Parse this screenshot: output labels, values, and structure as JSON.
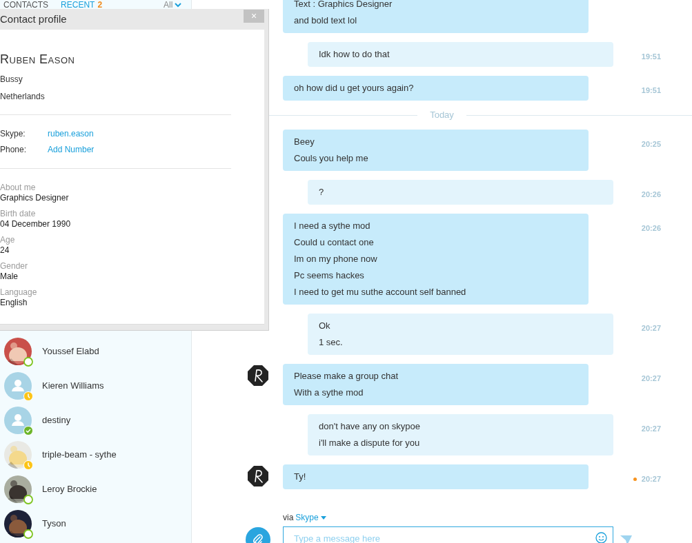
{
  "sidebar": {
    "tabs": [
      {
        "label": "CONTACTS",
        "selected": false
      },
      {
        "label": "RECENT",
        "badge": "2",
        "selected": true
      }
    ],
    "filter": "All",
    "contacts": [
      {
        "name": "Youssef Elabd",
        "away": false,
        "checked": false
      },
      {
        "name": "Kieren Williams",
        "kind": "default",
        "away": true,
        "checked": false
      },
      {
        "name": "destiny",
        "kind": "default",
        "away": false,
        "checked": true
      },
      {
        "name": "triple-beam - sythe",
        "away": true,
        "checked": false
      },
      {
        "name": "Leroy Brockie",
        "away": false,
        "checked": false
      },
      {
        "name": "Tyson",
        "away": false,
        "checked": false
      }
    ]
  },
  "profile": {
    "title": "Contact profile",
    "close": "×",
    "name": "Ruben Eason",
    "mood": "Bussy",
    "location": "Netherlands",
    "contact_fields": [
      {
        "label": "Skype:",
        "value": "ruben.eason"
      },
      {
        "label": "Phone:",
        "value": "Add Number"
      }
    ],
    "details": [
      {
        "label": "About me",
        "value": "Graphics Designer"
      },
      {
        "label": "Birth date",
        "value": "04 December 1990"
      },
      {
        "label": "Age",
        "value": "24"
      },
      {
        "label": "Gender",
        "value": "Male"
      },
      {
        "label": "Language",
        "value": "English"
      }
    ]
  },
  "chat": {
    "items": [
      {
        "kind": "incoming",
        "avatar": false,
        "unread": false,
        "lines": [
          "Text : Graphics Designer",
          "and bold text lol"
        ]
      },
      {
        "kind": "outgoing",
        "avatar": false,
        "unread": false,
        "lines": [
          "Idk how to do that"
        ],
        "time": "19:51"
      },
      {
        "kind": "incoming",
        "avatar": false,
        "unread": false,
        "lines": [
          "oh how did u get yours again?"
        ],
        "time": "19:51"
      },
      {
        "kind": "divider",
        "label": "Today"
      },
      {
        "kind": "incoming",
        "avatar": false,
        "unread": false,
        "lines": [
          "Beey",
          "Couls you help me"
        ],
        "time": "20:25"
      },
      {
        "kind": "outgoing",
        "avatar": false,
        "unread": false,
        "lines": [
          "?"
        ],
        "time": "20:26"
      },
      {
        "kind": "incoming",
        "avatar": false,
        "unread": false,
        "lines": [
          "I need a sythe mod",
          "Could u contact one",
          "Im on my phone now",
          "Pc seems hackes",
          "I need to get mu suthe account self banned"
        ],
        "time": "20:26"
      },
      {
        "kind": "outgoing",
        "avatar": false,
        "unread": false,
        "lines": [
          "Ok",
          "1 sec."
        ],
        "time": "20:27"
      },
      {
        "kind": "incoming",
        "avatar": true,
        "unread": false,
        "lines": [
          "Please make a group chat",
          "With a sythe mod"
        ],
        "time": "20:27"
      },
      {
        "kind": "outgoing",
        "avatar": false,
        "unread": false,
        "lines": [
          "don't have any on skypoe",
          "i'll make a dispute for you"
        ],
        "time": "20:27"
      },
      {
        "kind": "incoming",
        "avatar": true,
        "unread": true,
        "lines": [
          "Ty!"
        ],
        "time": "20:27"
      }
    ]
  },
  "composer": {
    "via": "via",
    "service": "Skype",
    "placeholder": "Type a message here"
  }
}
